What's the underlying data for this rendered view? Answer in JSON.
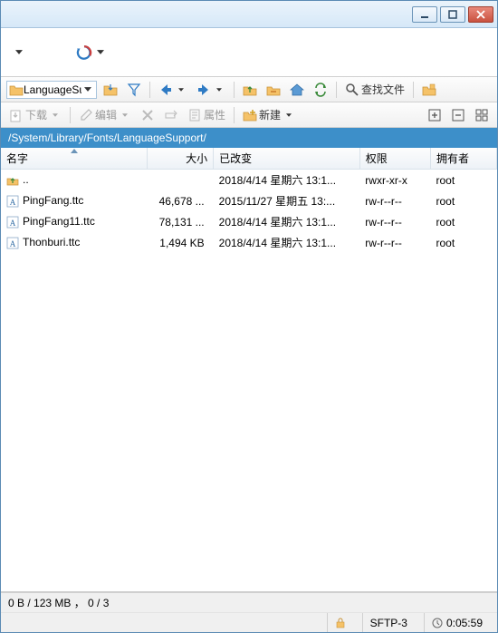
{
  "titlebar": {},
  "address": {
    "text": "LanguageSup"
  },
  "toolbar": {
    "find_label": "查找文件",
    "download_label": "下载",
    "edit_label": "编辑",
    "props_label": "属性",
    "new_label": "新建"
  },
  "path": "/System/Library/Fonts/LanguageSupport/",
  "columns": {
    "name": "名字",
    "size": "大小",
    "changed": "已改变",
    "perm": "权限",
    "owner": "拥有者"
  },
  "rows": [
    {
      "icon": "up",
      "name": "..",
      "size": "",
      "changed": "2018/4/14 星期六 13:1...",
      "perm": "rwxr-xr-x",
      "owner": "root"
    },
    {
      "icon": "font",
      "name": "PingFang.ttc",
      "size": "46,678 ...",
      "changed": "2015/11/27 星期五 13:...",
      "perm": "rw-r--r--",
      "owner": "root"
    },
    {
      "icon": "font",
      "name": "PingFang11.ttc",
      "size": "78,131 ...",
      "changed": "2018/4/14 星期六 13:1...",
      "perm": "rw-r--r--",
      "owner": "root"
    },
    {
      "icon": "font",
      "name": "Thonburi.ttc",
      "size": "1,494 KB",
      "changed": "2018/4/14 星期六 13:1...",
      "perm": "rw-r--r--",
      "owner": "root"
    }
  ],
  "status": {
    "selection": "0 B / 123 MB ， 0 / 3",
    "protocol": "SFTP-3",
    "time": "0:05:59"
  }
}
